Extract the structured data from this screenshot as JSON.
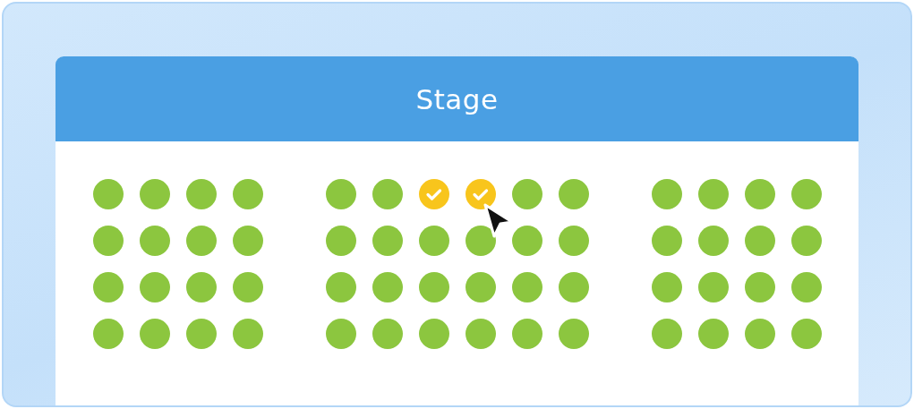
{
  "header": {
    "title": "Stage"
  },
  "sections": [
    {
      "rows": [
        [
          {
            "selected": false
          },
          {
            "selected": false
          },
          {
            "selected": false
          },
          {
            "selected": false
          }
        ],
        [
          {
            "selected": false
          },
          {
            "selected": false
          },
          {
            "selected": false
          },
          {
            "selected": false
          }
        ],
        [
          {
            "selected": false
          },
          {
            "selected": false
          },
          {
            "selected": false
          },
          {
            "selected": false
          }
        ],
        [
          {
            "selected": false
          },
          {
            "selected": false
          },
          {
            "selected": false
          },
          {
            "selected": false
          }
        ]
      ]
    },
    {
      "rows": [
        [
          {
            "selected": false
          },
          {
            "selected": false
          },
          {
            "selected": true
          },
          {
            "selected": true
          },
          {
            "selected": false
          },
          {
            "selected": false
          }
        ],
        [
          {
            "selected": false
          },
          {
            "selected": false
          },
          {
            "selected": false
          },
          {
            "selected": false
          },
          {
            "selected": false
          },
          {
            "selected": false
          }
        ],
        [
          {
            "selected": false
          },
          {
            "selected": false
          },
          {
            "selected": false
          },
          {
            "selected": false
          },
          {
            "selected": false
          },
          {
            "selected": false
          }
        ],
        [
          {
            "selected": false
          },
          {
            "selected": false
          },
          {
            "selected": false
          },
          {
            "selected": false
          },
          {
            "selected": false
          },
          {
            "selected": false
          }
        ]
      ]
    },
    {
      "rows": [
        [
          {
            "selected": false
          },
          {
            "selected": false
          },
          {
            "selected": false
          },
          {
            "selected": false
          }
        ],
        [
          {
            "selected": false
          },
          {
            "selected": false
          },
          {
            "selected": false
          },
          {
            "selected": false
          }
        ],
        [
          {
            "selected": false
          },
          {
            "selected": false
          },
          {
            "selected": false
          },
          {
            "selected": false
          }
        ],
        [
          {
            "selected": false
          },
          {
            "selected": false
          },
          {
            "selected": false
          },
          {
            "selected": false
          }
        ]
      ]
    }
  ]
}
